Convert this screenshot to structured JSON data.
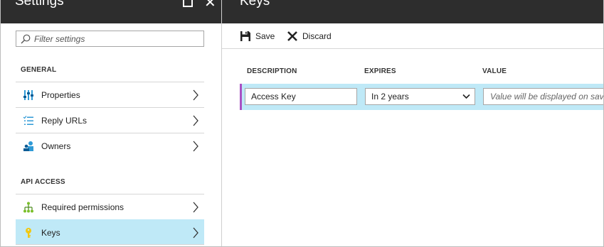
{
  "settings": {
    "title": "Settings",
    "filter_placeholder": "Filter settings",
    "sections": {
      "general": "GENERAL",
      "api_access": "API ACCESS"
    },
    "items": [
      {
        "label": "Properties",
        "icon": "properties-icon"
      },
      {
        "label": "Reply URLs",
        "icon": "list-icon"
      },
      {
        "label": "Owners",
        "icon": "users-icon"
      },
      {
        "label": "Required permissions",
        "icon": "permissions-icon"
      },
      {
        "label": "Keys",
        "icon": "key-icon",
        "selected": true
      }
    ]
  },
  "keys": {
    "title": "Keys",
    "toolbar": {
      "save_label": "Save",
      "discard_label": "Discard"
    },
    "columns": {
      "description": "DESCRIPTION",
      "expires": "EXPIRES",
      "value": "VALUE"
    },
    "row": {
      "description": "Access Key",
      "expires": "In 2 years",
      "value_placeholder": "Value will be displayed on save"
    }
  },
  "colors": {
    "header_bg": "#2d2d2d",
    "selected_bg": "#bfe9f7",
    "row_accent": "#a951c3"
  }
}
